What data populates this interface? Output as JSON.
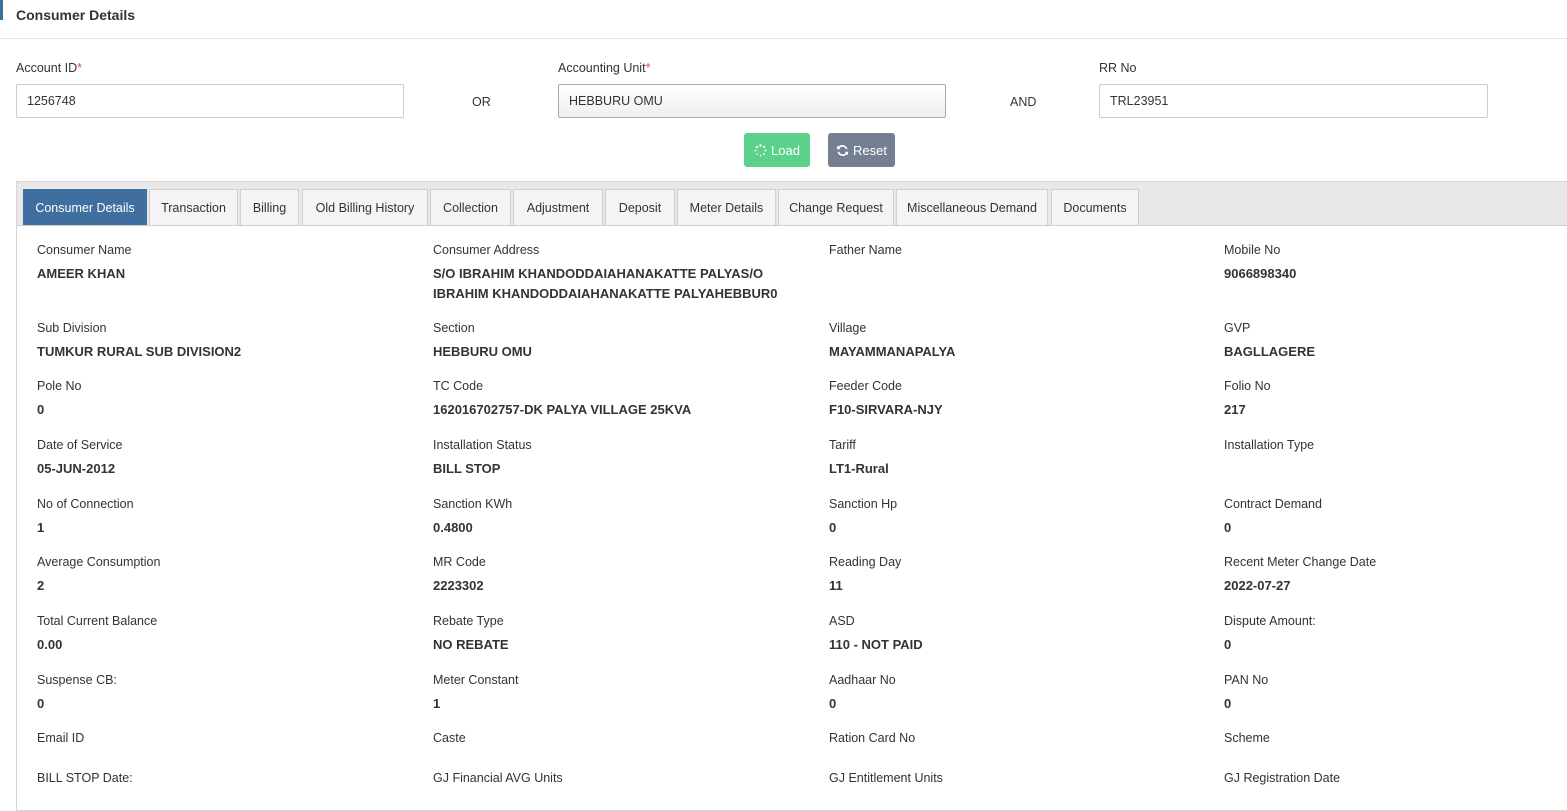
{
  "header": {
    "title": "Consumer Details"
  },
  "search": {
    "account_id_label": "Account ID",
    "account_id_value": "1256748",
    "or_label": "OR",
    "accounting_unit_label": "Accounting Unit",
    "accounting_unit_value": "HEBBURU OMU",
    "and_label": "AND",
    "rr_no_label": "RR No",
    "rr_no_value": "TRL23951",
    "required_mark": "*",
    "load_label": "Load",
    "reset_label": "Reset"
  },
  "tabs": [
    "Consumer Details",
    "Transaction",
    "Billing",
    "Old Billing History",
    "Collection",
    "Adjustment",
    "Deposit",
    "Meter Details",
    "Change Request",
    "Miscellaneous Demand",
    "Documents"
  ],
  "active_tab": "Consumer Details",
  "details": [
    [
      {
        "label": "Consumer Name",
        "value": "AMEER KHAN"
      },
      {
        "label": "Consumer Address",
        "value": "S/O IBRAHIM KHANDODDAIAHANAKATTE PALYAS/O IBRAHIM KHANDODDAIAHANAKATTE PALYAHEBBUR0"
      },
      {
        "label": "Father Name",
        "value": ""
      },
      {
        "label": "Mobile No",
        "value": "9066898340"
      }
    ],
    [
      {
        "label": "Sub Division",
        "value": "TUMKUR RURAL SUB DIVISION2"
      },
      {
        "label": "Section",
        "value": "HEBBURU OMU"
      },
      {
        "label": "Village",
        "value": "MAYAMMANAPALYA"
      },
      {
        "label": "GVP",
        "value": "BAGLLAGERE"
      }
    ],
    [
      {
        "label": "Pole No",
        "value": "0"
      },
      {
        "label": "TC Code",
        "value": "162016702757-DK PALYA VILLAGE 25KVA"
      },
      {
        "label": "Feeder Code",
        "value": "F10-SIRVARA-NJY"
      },
      {
        "label": "Folio No",
        "value": "217"
      }
    ],
    [
      {
        "label": "Date of Service",
        "value": "05-JUN-2012"
      },
      {
        "label": "Installation Status",
        "value": "BILL STOP"
      },
      {
        "label": "Tariff",
        "value": "LT1-Rural"
      },
      {
        "label": "Installation Type",
        "value": ""
      }
    ],
    [
      {
        "label": "No of Connection",
        "value": "1"
      },
      {
        "label": "Sanction KWh",
        "value": "0.4800"
      },
      {
        "label": "Sanction Hp",
        "value": "0"
      },
      {
        "label": "Contract Demand",
        "value": "0"
      }
    ],
    [
      {
        "label": "Average Consumption",
        "value": "2"
      },
      {
        "label": "MR Code",
        "value": "2223302"
      },
      {
        "label": "Reading Day",
        "value": "11"
      },
      {
        "label": "Recent Meter Change Date",
        "value": "2022-07-27"
      }
    ],
    [
      {
        "label": "Total Current Balance",
        "value": "0.00"
      },
      {
        "label": "Rebate Type",
        "value": "NO REBATE"
      },
      {
        "label": "ASD",
        "value": "110 - NOT PAID"
      },
      {
        "label": "Dispute Amount:",
        "value": "0"
      }
    ],
    [
      {
        "label": "Suspense CB:",
        "value": "0"
      },
      {
        "label": "Meter Constant",
        "value": "1"
      },
      {
        "label": "Aadhaar No",
        "value": "0"
      },
      {
        "label": "PAN No",
        "value": "0"
      }
    ],
    [
      {
        "label": "Email ID",
        "value": ""
      },
      {
        "label": "Caste",
        "value": ""
      },
      {
        "label": "Ration Card No",
        "value": ""
      },
      {
        "label": "Scheme",
        "value": ""
      }
    ],
    [
      {
        "label": "BILL STOP Date:",
        "value": ""
      },
      {
        "label": "GJ Financial AVG Units",
        "value": ""
      },
      {
        "label": "GJ Entitlement Units",
        "value": ""
      },
      {
        "label": "GJ Registration Date",
        "value": ""
      }
    ]
  ]
}
